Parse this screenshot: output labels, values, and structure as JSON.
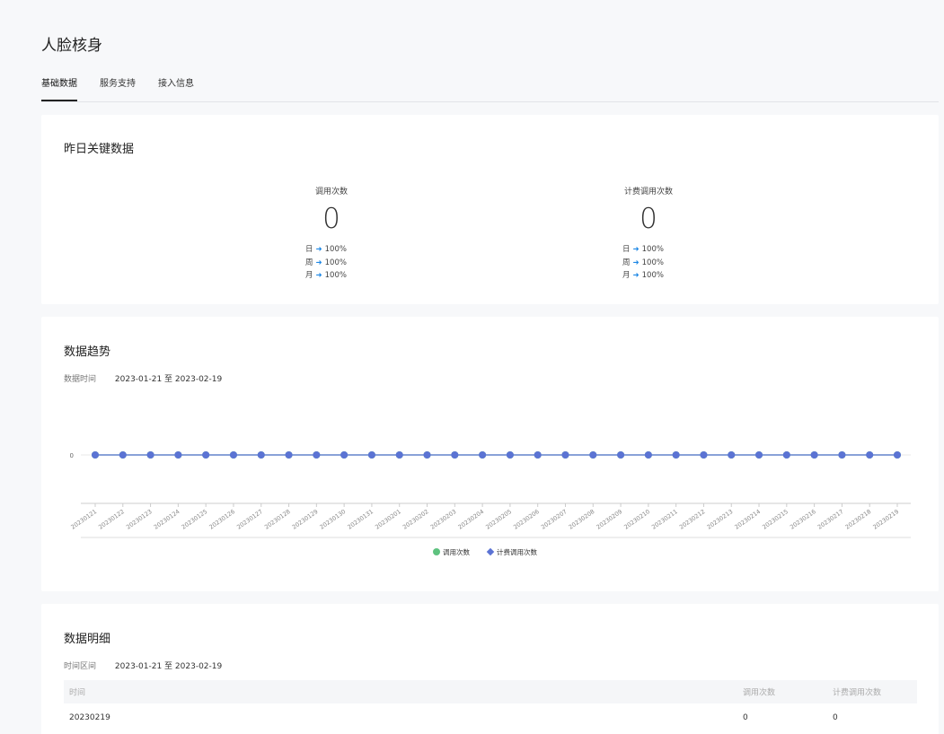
{
  "page": {
    "title": "人脸核身"
  },
  "tabs": [
    {
      "label": "基础数据",
      "active": true
    },
    {
      "label": "服务支持",
      "active": false
    },
    {
      "label": "接入信息",
      "active": false
    }
  ],
  "key_data": {
    "title": "昨日关键数据",
    "metrics": [
      {
        "label": "调用次数",
        "value": "0",
        "rows": [
          {
            "label": "日",
            "value": "100%"
          },
          {
            "label": "周",
            "value": "100%"
          },
          {
            "label": "月",
            "value": "100%"
          }
        ]
      },
      {
        "label": "计费调用次数",
        "value": "0",
        "rows": [
          {
            "label": "日",
            "value": "100%"
          },
          {
            "label": "周",
            "value": "100%"
          },
          {
            "label": "月",
            "value": "100%"
          }
        ]
      }
    ]
  },
  "trend": {
    "title": "数据趋势",
    "range_label": "数据时间",
    "range_value": "2023-01-21 至 2023-02-19"
  },
  "chart_data": {
    "type": "line",
    "title": "",
    "x": [
      "20230121",
      "20230122",
      "20230123",
      "20230124",
      "20230125",
      "20230126",
      "20230127",
      "20230128",
      "20230129",
      "20230130",
      "20230131",
      "20230201",
      "20230202",
      "20230203",
      "20230204",
      "20230205",
      "20230206",
      "20230207",
      "20230208",
      "20230209",
      "20230210",
      "20230211",
      "20230212",
      "20230213",
      "20230214",
      "20230215",
      "20230216",
      "20230217",
      "20230218",
      "20230219"
    ],
    "series": [
      {
        "name": "调用次数",
        "values": [
          0,
          0,
          0,
          0,
          0,
          0,
          0,
          0,
          0,
          0,
          0,
          0,
          0,
          0,
          0,
          0,
          0,
          0,
          0,
          0,
          0,
          0,
          0,
          0,
          0,
          0,
          0,
          0,
          0,
          0
        ],
        "color": "#5ec27f",
        "marker": "circle"
      },
      {
        "name": "计费调用次数",
        "values": [
          0,
          0,
          0,
          0,
          0,
          0,
          0,
          0,
          0,
          0,
          0,
          0,
          0,
          0,
          0,
          0,
          0,
          0,
          0,
          0,
          0,
          0,
          0,
          0,
          0,
          0,
          0,
          0,
          0,
          0
        ],
        "color": "#5b73d4",
        "marker": "diamond"
      }
    ],
    "yticks": [
      "0"
    ],
    "grid": true,
    "legend_position": "bottom"
  },
  "detail": {
    "title": "数据明细",
    "range_label": "时间区间",
    "range_value": "2023-01-21 至 2023-02-19",
    "columns": [
      "时间",
      "调用次数",
      "计费调用次数"
    ],
    "rows": [
      [
        "20230219",
        "0",
        "0"
      ]
    ]
  }
}
